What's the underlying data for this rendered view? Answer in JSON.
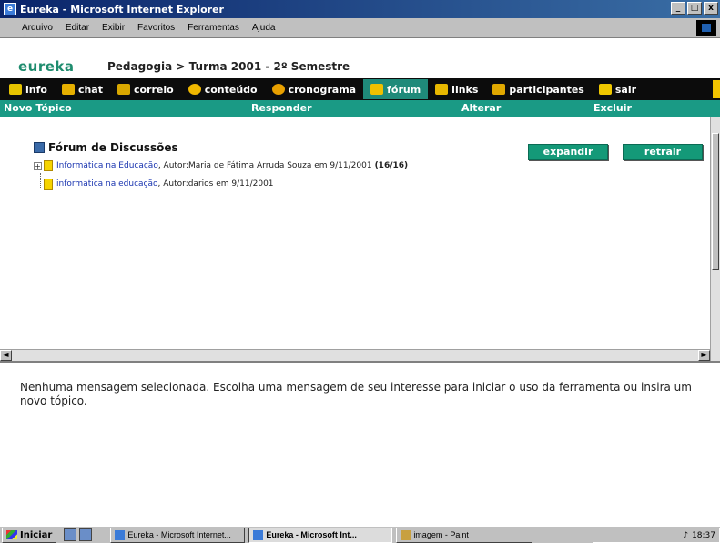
{
  "window": {
    "title": "Eureka - Microsoft Internet Explorer",
    "controls": [
      "_",
      "□",
      "x"
    ]
  },
  "menu": [
    {
      "label": "Arquivo"
    },
    {
      "label": "Editar"
    },
    {
      "label": "Exibir"
    },
    {
      "label": "Favoritos"
    },
    {
      "label": "Ferramentas"
    },
    {
      "label": "Ajuda"
    }
  ],
  "header": {
    "brand": "eureka",
    "breadcrumb": "Pedagogia > Turma 2001 - 2º Semestre"
  },
  "nav": {
    "items": [
      {
        "label": "info",
        "icon": "info-icon",
        "color": "#e7c400"
      },
      {
        "label": "chat",
        "icon": "chat-icon",
        "color": "#e7b000"
      },
      {
        "label": "correio",
        "icon": "mail-icon",
        "color": "#d9a800"
      },
      {
        "label": "conteúdo",
        "icon": "content-icon",
        "color": "#f0b800"
      },
      {
        "label": "cronograma",
        "icon": "clock-icon",
        "color": "#e8a000"
      },
      {
        "label": "fórum",
        "icon": "forum-icon",
        "color": "#f0c000",
        "active": true
      },
      {
        "label": "links",
        "icon": "links-icon",
        "color": "#e8b800"
      },
      {
        "label": "participantes",
        "icon": "participants-icon",
        "color": "#e0a800"
      },
      {
        "label": "sair",
        "icon": "exit-icon",
        "color": "#f0c800"
      }
    ]
  },
  "actions": {
    "new_topic": "Novo Tópico",
    "reply": "Responder",
    "edit": "Alterar",
    "delete": "Excluir"
  },
  "forum": {
    "title": "Fórum de Discussões",
    "expand": "expandir",
    "collapse": "retrair",
    "topics": [
      {
        "title": "Informática na Educação",
        "meta": ", Autor:Maria de Fátima Arruda Souza em 9/11/2001",
        "count": "(16/16)"
      },
      {
        "title": "informatica na educação",
        "meta": ", Autor:darios em 9/11/2001",
        "count": ""
      }
    ]
  },
  "message": {
    "text": "Nenhuma mensagem selecionada. Escolha uma mensagem de seu interesse para iniciar o uso da ferramenta ou insira um novo tópico."
  },
  "taskbar": {
    "start": "Iniciar",
    "tasks": [
      {
        "label": "Eureka - Microsoft Internet...",
        "active": false
      },
      {
        "label": "Eureka - Microsoft Int...",
        "active": true
      },
      {
        "label": "imagem - Paint",
        "active": false
      }
    ],
    "clock": "18:37"
  }
}
